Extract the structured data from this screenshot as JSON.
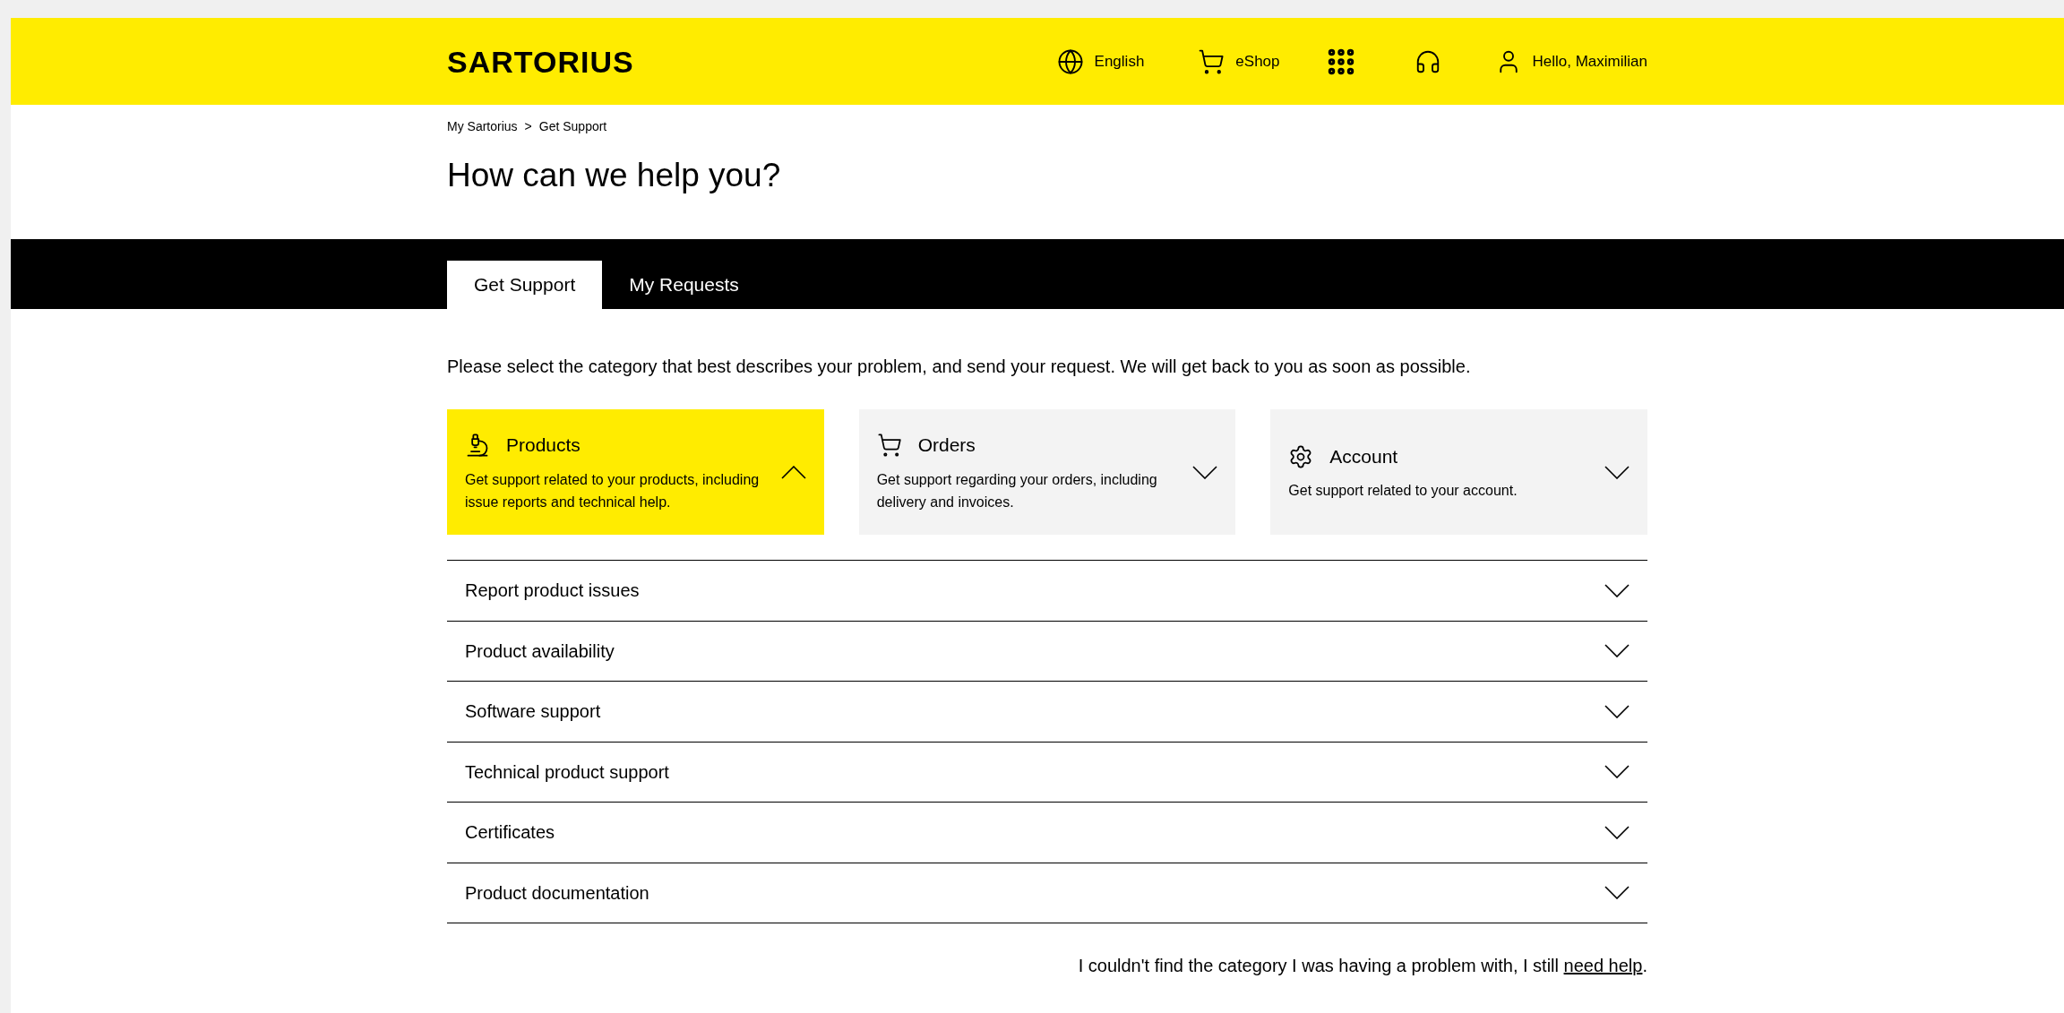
{
  "header": {
    "logo": "SARTORIUS",
    "language": "English",
    "shop": "eShop",
    "greeting": "Hello, Maximilian"
  },
  "breadcrumb": [
    "My Sartorius",
    "Get Support"
  ],
  "breadcrumb_separator": ">",
  "title": "How can we help you?",
  "tabs": [
    {
      "label": "Get Support",
      "selected": true
    },
    {
      "label": "My Requests",
      "selected": false
    }
  ],
  "intro": "Please select the category that best describes your problem, and send your request. We will get back to you as soon as possible.",
  "categories": [
    {
      "kind": "products",
      "title": "Products",
      "description": "Get support related to your products, including issue reports and technical help.",
      "selected": true
    },
    {
      "kind": "orders",
      "title": "Orders",
      "description": "Get support regarding your orders, including delivery and invoices.",
      "selected": false
    },
    {
      "kind": "account",
      "title": "Account",
      "description": "Get support related to your account.",
      "selected": false
    }
  ],
  "topics": [
    {
      "label": "Report product issues",
      "expanded": false
    },
    {
      "label": "Product availability",
      "expanded": false
    },
    {
      "label": "Software support",
      "expanded": false
    },
    {
      "label": "Technical product support",
      "expanded": false
    },
    {
      "label": "Certificates",
      "expanded": false
    },
    {
      "label": "Product documentation",
      "expanded": false
    }
  ],
  "footer": {
    "text_before": "I couldn't find the category I was having a problem with, I still ",
    "link": "need help",
    "text_after": "."
  }
}
